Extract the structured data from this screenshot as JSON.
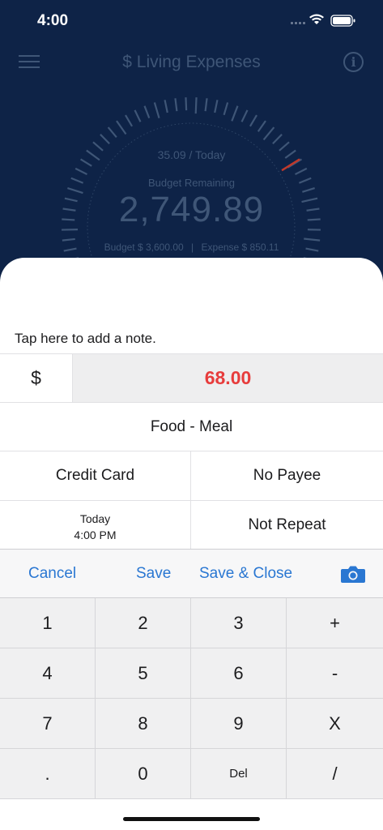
{
  "status_bar": {
    "time": "4:00"
  },
  "nav": {
    "title": "$ Living Expenses",
    "info_glyph": "i"
  },
  "gauge": {
    "today_text": "35.09 / Today",
    "remaining_label": "Budget Remaining",
    "remaining_value": "2,749.89",
    "budget_text": "Budget $ 3,600.00",
    "separator": "|",
    "expense_text": "Expense $ 850.11",
    "spent_fraction": 0.236,
    "marker_color": "#c0392b"
  },
  "sheet": {
    "note_placeholder": "Tap here to add a note.",
    "currency_symbol": "$",
    "amount": "68.00",
    "amount_color": "#e73c3c",
    "category": "Food - Meal",
    "account": "Credit Card",
    "payee": "No Payee",
    "date_line1": "Today",
    "date_line2": "4:00 PM",
    "repeat": "Not Repeat"
  },
  "actions": {
    "cancel": "Cancel",
    "save": "Save",
    "save_close": "Save & Close",
    "camera_icon": "camera-icon"
  },
  "keypad": {
    "keys": [
      "1",
      "2",
      "3",
      "+",
      "4",
      "5",
      "6",
      "-",
      "7",
      "8",
      "9",
      "X",
      ".",
      "0",
      "Del",
      "/"
    ]
  },
  "colors": {
    "background": "#0e2347",
    "accent": "#2a77d2",
    "amount": "#e73c3c"
  }
}
